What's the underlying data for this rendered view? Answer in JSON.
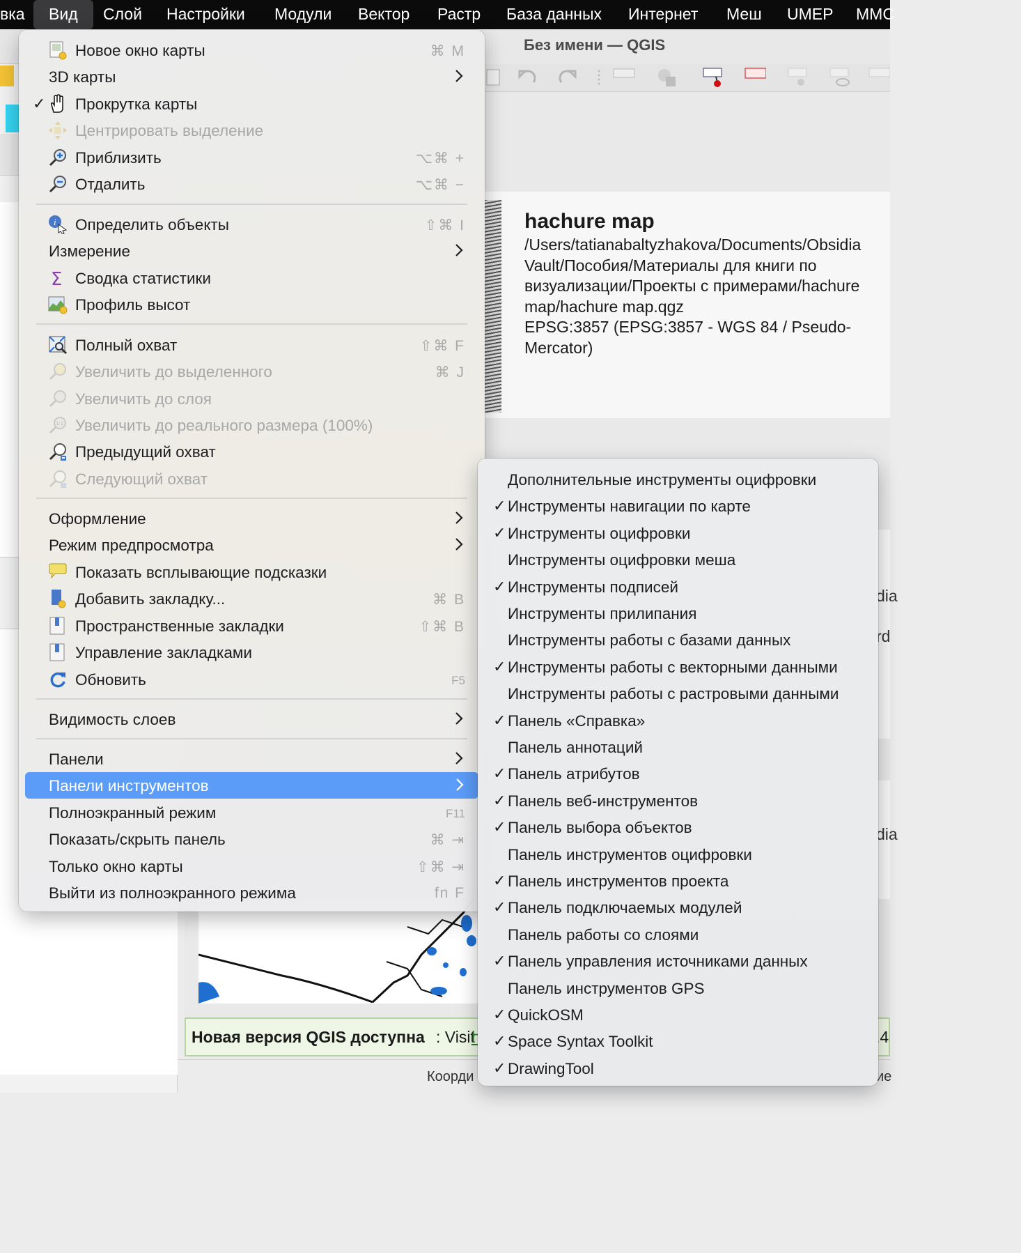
{
  "menubar": {
    "items": [
      "вка",
      "Вид",
      "Слой",
      "Настройки",
      "Модули",
      "Вектор",
      "Растр",
      "База данных",
      "Интернет",
      "Меш",
      "UMEP",
      "MMC"
    ],
    "active": "Вид"
  },
  "window": {
    "title": "Без имени — QGIS"
  },
  "project": {
    "name": "hachure map",
    "path": "/Users/tatianabaltyzhakova/Documents/Obsidia\nVault/Пособия/Материалы для книги по\nвизуализации/Проекты с примерами/hachure\nmap/hachure map.qgz",
    "crs": "EPSG:3857 (EPSG:3857 - WGS 84 / Pseudo-Mercator)"
  },
  "background_edge_text": [
    "dia",
    "rd",
    "dia"
  ],
  "update_bar": {
    "bold": "Новая версия QGIS доступна",
    "colon_text": ": Visit",
    "link": "h",
    "right_edge": ".4"
  },
  "status_bar": {
    "coords_label": "Коорди",
    "right_edge": "ие"
  },
  "view_menu": {
    "items": [
      {
        "label": "Новое окно карты",
        "shortcut": "⌘ M",
        "icon": "new-map-window-icon"
      },
      {
        "label": "3D карты",
        "submenu": true
      },
      {
        "label": "Прокрутка карты",
        "checked": true,
        "icon": "pan-hand-icon"
      },
      {
        "label": "Центрировать выделение",
        "disabled": true,
        "icon": "pan-to-selection-icon"
      },
      {
        "label": "Приблизить",
        "shortcut": "⌥⌘ +",
        "icon": "zoom-in-icon"
      },
      {
        "label": "Отдалить",
        "shortcut": "⌥⌘ −",
        "icon": "zoom-out-icon"
      },
      {
        "label": "Определить объекты",
        "shortcut": "⇧⌘ I",
        "icon": "identify-icon"
      },
      {
        "label": "Измерение",
        "submenu": true
      },
      {
        "label": "Сводка статистики",
        "icon": "sigma-icon"
      },
      {
        "label": "Профиль высот",
        "icon": "elevation-profile-icon"
      },
      {
        "label": "Полный охват",
        "shortcut": "⇧⌘ F",
        "icon": "zoom-full-icon"
      },
      {
        "label": "Увеличить до выделенного",
        "shortcut": "⌘ J",
        "disabled": true,
        "icon": "zoom-to-selected-icon"
      },
      {
        "label": "Увеличить до слоя",
        "disabled": true,
        "icon": "zoom-to-layer-icon"
      },
      {
        "label": "Увеличить до реального размера (100%)",
        "disabled": true,
        "icon": "zoom-actual-icon"
      },
      {
        "label": "Предыдущий охват",
        "icon": "zoom-last-icon"
      },
      {
        "label": "Следующий охват",
        "disabled": true,
        "icon": "zoom-next-icon"
      },
      {
        "label": "Оформление",
        "submenu": true
      },
      {
        "label": "Режим предпросмотра",
        "submenu": true
      },
      {
        "label": "Показать всплывающие подсказки",
        "icon": "map-tips-icon"
      },
      {
        "label": "Добавить закладку...",
        "shortcut": "⌘ B",
        "icon": "new-bookmark-icon"
      },
      {
        "label": "Пространственные закладки",
        "shortcut": "⇧⌘ B",
        "icon": "bookmarks-icon"
      },
      {
        "label": "Управление закладками",
        "icon": "manage-bookmarks-icon"
      },
      {
        "label": "Обновить",
        "shortcut": "F5",
        "icon": "refresh-icon"
      },
      {
        "label": "Видимость слоев",
        "submenu": true
      },
      {
        "label": "Панели",
        "submenu": true
      },
      {
        "label": "Панели инструментов",
        "submenu": true,
        "highlighted": true
      },
      {
        "label": "Полноэкранный режим",
        "shortcut": "F11"
      },
      {
        "label": "Показать/скрыть панель",
        "shortcut": "⌘ ⇥"
      },
      {
        "label": "Только окно карты",
        "shortcut": "⇧⌘ ⇥"
      },
      {
        "label": "Выйти из полноэкранного режима",
        "shortcut": "fn F"
      }
    ]
  },
  "toolbars_submenu": {
    "items": [
      {
        "label": "Дополнительные инструменты оцифровки",
        "checked": false
      },
      {
        "label": "Инструменты навигации по карте",
        "checked": true
      },
      {
        "label": "Инструменты оцифровки",
        "checked": true
      },
      {
        "label": "Инструменты оцифровки меша",
        "checked": false
      },
      {
        "label": "Инструменты подписей",
        "checked": true
      },
      {
        "label": "Инструменты прилипания",
        "checked": false
      },
      {
        "label": "Инструменты работы с базами данных",
        "checked": false
      },
      {
        "label": "Инструменты работы с векторными данными",
        "checked": true
      },
      {
        "label": "Инструменты работы с растровыми данными",
        "checked": false
      },
      {
        "label": "Панель «Справка»",
        "checked": true
      },
      {
        "label": "Панель аннотаций",
        "checked": false
      },
      {
        "label": "Панель атрибутов",
        "checked": true
      },
      {
        "label": "Панель веб-инструментов",
        "checked": true
      },
      {
        "label": "Панель выбора объектов",
        "checked": true
      },
      {
        "label": "Панель инструментов оцифровки",
        "checked": false
      },
      {
        "label": "Панель инструментов проекта",
        "checked": true
      },
      {
        "label": "Панель подключаемых модулей",
        "checked": true
      },
      {
        "label": "Панель работы со слоями",
        "checked": false
      },
      {
        "label": "Панель управления источниками данных",
        "checked": true
      },
      {
        "label": "Панель инструментов GPS",
        "checked": false
      },
      {
        "label": "QuickOSM",
        "checked": true
      },
      {
        "label": "Space Syntax Toolkit",
        "checked": true
      },
      {
        "label": "DrawingTool",
        "checked": true
      }
    ],
    "check_glyph": "✓"
  },
  "colors": {
    "highlight": "#5b9cf8",
    "menubar_bg": "#0b0b0b"
  }
}
